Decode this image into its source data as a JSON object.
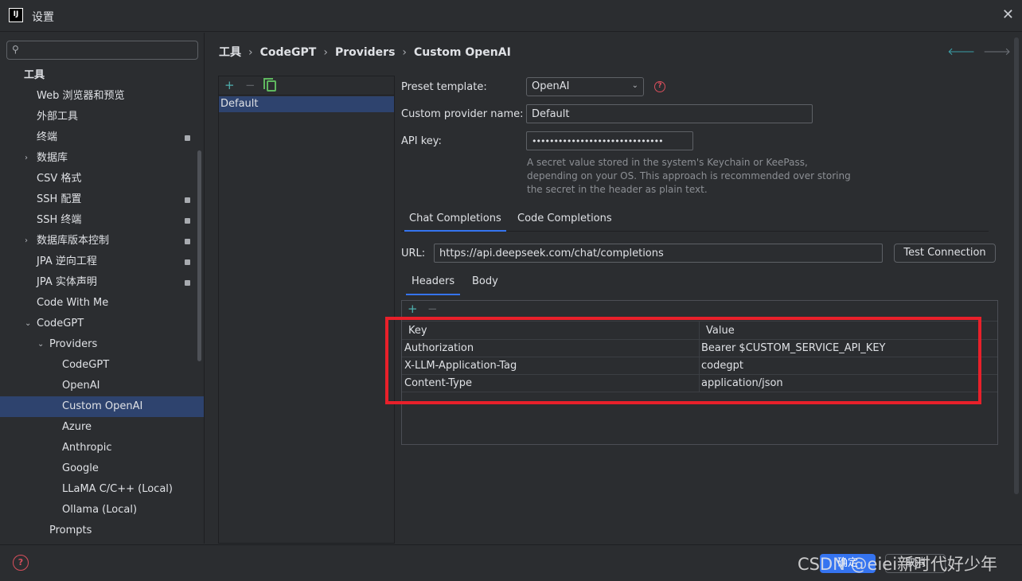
{
  "window": {
    "title": "设置",
    "logo_text": "IJ"
  },
  "sidebar": {
    "search_placeholder": "",
    "items": [
      {
        "label": "工具",
        "level": 0,
        "arrow": "",
        "badge": false,
        "selected": false
      },
      {
        "label": "Web 浏览器和预览",
        "level": 1,
        "arrow": "",
        "badge": false,
        "selected": false
      },
      {
        "label": "外部工具",
        "level": 1,
        "arrow": "",
        "badge": false,
        "selected": false
      },
      {
        "label": "终端",
        "level": 1,
        "arrow": "",
        "badge": true,
        "selected": false
      },
      {
        "label": "数据库",
        "level": 1,
        "arrow": "›",
        "badge": false,
        "selected": false
      },
      {
        "label": "CSV 格式",
        "level": 1,
        "arrow": "",
        "badge": false,
        "selected": false
      },
      {
        "label": "SSH 配置",
        "level": 1,
        "arrow": "",
        "badge": true,
        "selected": false
      },
      {
        "label": "SSH 终端",
        "level": 1,
        "arrow": "",
        "badge": true,
        "selected": false
      },
      {
        "label": "数据库版本控制",
        "level": 1,
        "arrow": "›",
        "badge": true,
        "selected": false
      },
      {
        "label": "JPA 逆向工程",
        "level": 1,
        "arrow": "",
        "badge": true,
        "selected": false
      },
      {
        "label": "JPA 实体声明",
        "level": 1,
        "arrow": "",
        "badge": true,
        "selected": false
      },
      {
        "label": "Code With Me",
        "level": 1,
        "arrow": "",
        "badge": false,
        "selected": false
      },
      {
        "label": "CodeGPT",
        "level": 1,
        "arrow": "⌄",
        "badge": false,
        "selected": false
      },
      {
        "label": "Providers",
        "level": 2,
        "arrow": "⌄",
        "badge": false,
        "selected": false
      },
      {
        "label": "CodeGPT",
        "level": 3,
        "arrow": "",
        "badge": false,
        "selected": false
      },
      {
        "label": "OpenAI",
        "level": 3,
        "arrow": "",
        "badge": false,
        "selected": false
      },
      {
        "label": "Custom OpenAI",
        "level": 3,
        "arrow": "",
        "badge": false,
        "selected": true
      },
      {
        "label": "Azure",
        "level": 3,
        "arrow": "",
        "badge": false,
        "selected": false
      },
      {
        "label": "Anthropic",
        "level": 3,
        "arrow": "",
        "badge": false,
        "selected": false
      },
      {
        "label": "Google",
        "level": 3,
        "arrow": "",
        "badge": false,
        "selected": false
      },
      {
        "label": "LLaMA C/C++ (Local)",
        "level": 3,
        "arrow": "",
        "badge": false,
        "selected": false
      },
      {
        "label": "Ollama (Local)",
        "level": 3,
        "arrow": "",
        "badge": false,
        "selected": false
      },
      {
        "label": "Prompts",
        "level": 2,
        "arrow": "",
        "badge": false,
        "selected": false
      }
    ]
  },
  "breadcrumb": [
    "工具",
    "CodeGPT",
    "Providers",
    "Custom OpenAI"
  ],
  "providers": {
    "items": [
      "Default"
    ]
  },
  "form": {
    "preset_label": "Preset template:",
    "preset_value": "OpenAI",
    "name_label": "Custom provider name:",
    "name_value": "Default",
    "apikey_label": "API key:",
    "apikey_value": "••••••••••••••••••••••••••••••",
    "hint": "A secret value stored in the system's Keychain or KeePass, depending on your OS. This approach is recommended over storing the secret in the header as plain text.",
    "tabs": [
      "Chat Completions",
      "Code Completions"
    ],
    "url_label": "URL:",
    "url_value": "https://api.deepseek.com/chat/completions",
    "test_button": "Test Connection",
    "subtabs": [
      "Headers",
      "Body"
    ],
    "headers_table": {
      "columns": [
        "Key",
        "Value"
      ],
      "rows": [
        [
          "Authorization",
          "Bearer $CUSTOM_SERVICE_API_KEY"
        ],
        [
          "X-LLM-Application-Tag",
          "codegpt"
        ],
        [
          "Content-Type",
          "application/json"
        ]
      ]
    }
  },
  "footer": {
    "ok": "确定",
    "cancel": "取消",
    "watermark": "CSDN @eiei新时代好少年"
  },
  "colors": {
    "accent": "#3574f0",
    "selection": "#2e436e",
    "highlight": "#e8202a",
    "help": "#d94f5c"
  }
}
